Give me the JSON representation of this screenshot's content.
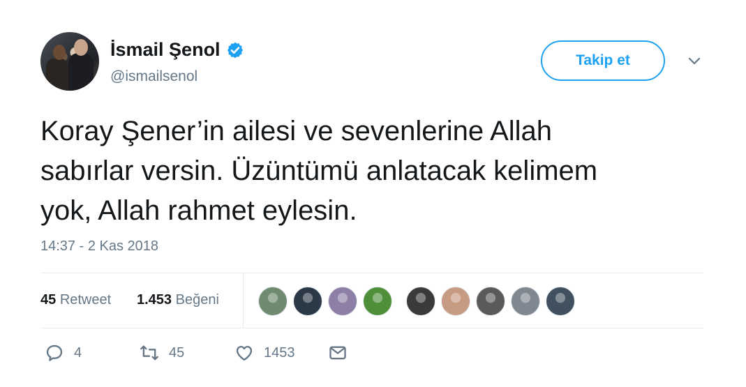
{
  "author": {
    "display_name": "İsmail Şenol",
    "handle": "@ismailsenol"
  },
  "follow_button": {
    "label": "Takip et"
  },
  "tweet": {
    "text_lines": [
      "Koray Şener’in ailesi ve sevenlerine Allah",
      "sabırlar versin. Üzüntümü anlatacak kelimem",
      "yok, Allah rahmet eylesin."
    ],
    "timestamp": "14:37 - 2 Kas 2018"
  },
  "stats": {
    "retweet_count": "45",
    "retweet_label": "Retweet",
    "like_count": "1.453",
    "like_label": "Beğeni"
  },
  "likers": [
    {
      "icon": "liker-avatar-1",
      "color": "#6f8a6e"
    },
    {
      "icon": "liker-avatar-2",
      "color": "#2b3947"
    },
    {
      "icon": "liker-avatar-3",
      "color": "#8d7fa6"
    },
    {
      "icon": "liker-avatar-4",
      "color": "#4f8f3a"
    },
    {
      "icon": "liker-avatar-5",
      "color": "#3a3a3a"
    },
    {
      "icon": "liker-avatar-6",
      "color": "#c79a82"
    },
    {
      "icon": "liker-avatar-7",
      "color": "#5a5a5a"
    },
    {
      "icon": "liker-avatar-8",
      "color": "#7f8790"
    },
    {
      "icon": "liker-avatar-9",
      "color": "#41505f"
    }
  ],
  "actions": {
    "reply_count": "4",
    "retweet_count": "45",
    "like_count": "1453"
  },
  "colors": {
    "accent": "#1da1f2",
    "secondary_text": "#657786",
    "divider": "#e6ecf0"
  }
}
